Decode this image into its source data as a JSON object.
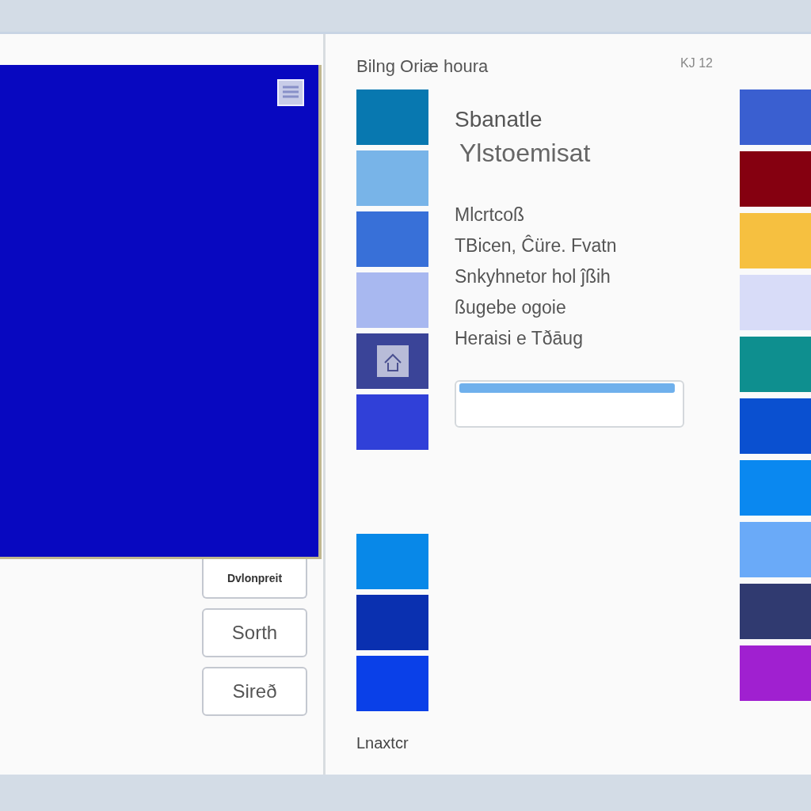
{
  "preview": {
    "color": "#0808c0"
  },
  "buttons": [
    "Dvlonpreit",
    "Sorth",
    "Sireð"
  ],
  "panel": {
    "title": "Bilng Oriæ houra",
    "code": "KJ 12"
  },
  "swatches_top": [
    {
      "color": "#0878b0"
    },
    {
      "color": "#78b4e8"
    },
    {
      "color": "#3870d8"
    },
    {
      "color": "#a8b8f0"
    },
    {
      "color": "#3a4498",
      "kind": "icon"
    },
    {
      "color": "#3040d8"
    }
  ],
  "swatches_bottom": [
    {
      "color": "#0888e8"
    },
    {
      "color": "#0a30b0"
    },
    {
      "color": "#0a40e8"
    }
  ],
  "heading": "Sbanatle",
  "subheading": "Ylstoemisat",
  "lines": [
    "Mlcrtcoß",
    "TBicen, Ĉüre. Fvatn",
    "Snkyhnetor hol ĵßih",
    "ßugebe ogoie",
    "Heraisi e Tðāug"
  ],
  "progress": {
    "level": 0.98
  },
  "swatches_right": [
    {
      "color": "#3a5fd0"
    },
    {
      "color": "#850010"
    },
    {
      "color": "#f6c040"
    },
    {
      "color": "#d8dcf8"
    },
    {
      "color": "#0e8f8f"
    },
    {
      "color": "#0a50d0"
    },
    {
      "color": "#0a88f0"
    },
    {
      "color": "#6aaaf8"
    },
    {
      "color": "#303a70"
    },
    {
      "color": "#a020d0"
    }
  ],
  "footer": "Lnaxtcr"
}
